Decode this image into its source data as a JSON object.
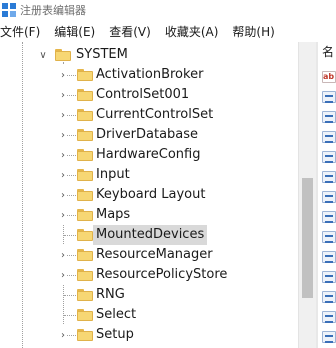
{
  "window": {
    "title": "注册表编辑器",
    "app_icon": "registry-editor-icon"
  },
  "menu": [
    {
      "label": "文件(F)"
    },
    {
      "label": "编辑(E)"
    },
    {
      "label": "查看(V)"
    },
    {
      "label": "收藏夹(A)"
    },
    {
      "label": "帮助(H)"
    }
  ],
  "tree": {
    "parent": {
      "label": "SYSTEM",
      "expanded": true
    },
    "children": [
      {
        "label": "ActivationBroker",
        "has_children": true,
        "selected": false
      },
      {
        "label": "ControlSet001",
        "has_children": true,
        "selected": false
      },
      {
        "label": "CurrentControlSet",
        "has_children": true,
        "selected": false
      },
      {
        "label": "DriverDatabase",
        "has_children": true,
        "selected": false
      },
      {
        "label": "HardwareConfig",
        "has_children": true,
        "selected": false
      },
      {
        "label": "Input",
        "has_children": true,
        "selected": false
      },
      {
        "label": "Keyboard Layout",
        "has_children": true,
        "selected": false
      },
      {
        "label": "Maps",
        "has_children": true,
        "selected": false
      },
      {
        "label": "MountedDevices",
        "has_children": false,
        "selected": true
      },
      {
        "label": "ResourceManager",
        "has_children": true,
        "selected": false
      },
      {
        "label": "ResourcePolicyStore",
        "has_children": true,
        "selected": false
      },
      {
        "label": "RNG",
        "has_children": false,
        "selected": false
      },
      {
        "label": "Select",
        "has_children": false,
        "selected": false
      },
      {
        "label": "Setup",
        "has_children": true,
        "selected": false
      }
    ]
  },
  "right_pane": {
    "header_label": "名",
    "value_icons": [
      "string-value-icon",
      "binary-value-icon",
      "binary-value-icon",
      "binary-value-icon",
      "binary-value-icon",
      "binary-value-icon",
      "binary-value-icon",
      "binary-value-icon",
      "binary-value-icon",
      "binary-value-icon",
      "binary-value-icon",
      "binary-value-icon",
      "binary-value-icon",
      "binary-value-icon"
    ],
    "string_icon_text": "ab"
  },
  "colors": {
    "folder": "#f7d774",
    "selection": "#d9d9d9",
    "scrollbar_thumb": "#c1c1c1",
    "accent": "#2b7bd6"
  }
}
